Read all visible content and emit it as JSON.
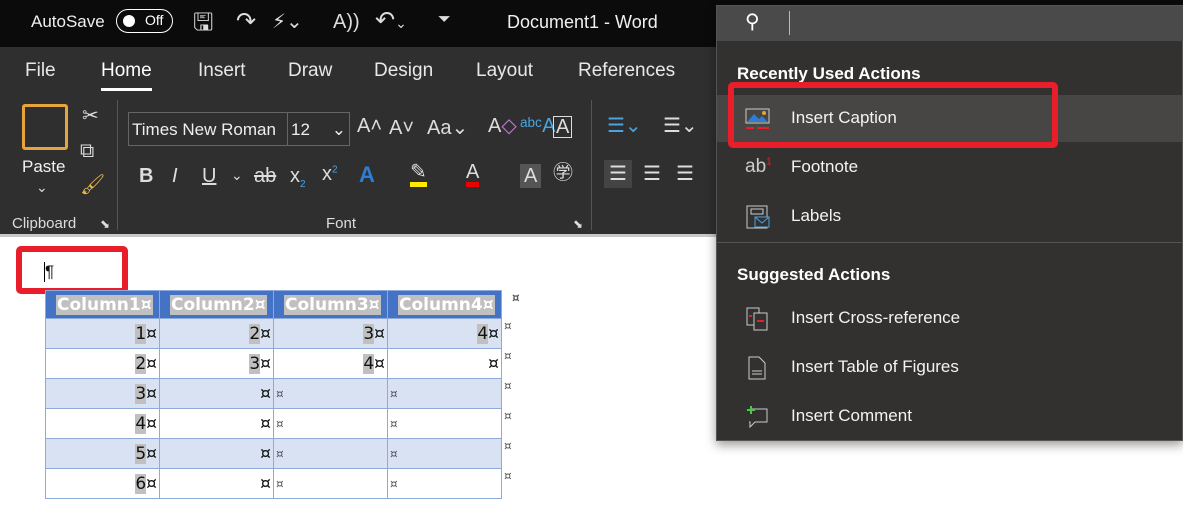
{
  "titlebar": {
    "autosave_label": "AutoSave",
    "autosave_state": "Off",
    "document_title": "Document1  -  Word"
  },
  "tabs": [
    {
      "label": "File"
    },
    {
      "label": "Home"
    },
    {
      "label": "Insert"
    },
    {
      "label": "Draw"
    },
    {
      "label": "Design"
    },
    {
      "label": "Layout"
    },
    {
      "label": "References"
    }
  ],
  "ribbon": {
    "paste_label": "Paste",
    "font_name": "Times New Roman",
    "font_size": "12",
    "clipboard_group": "Clipboard",
    "font_group": "Font"
  },
  "document": {
    "pilcrow": "¶",
    "table": {
      "headers": [
        "Column1¤",
        "Column2¤",
        "Column3¤",
        "Column4¤"
      ],
      "rows": [
        [
          "1",
          "2",
          "3",
          "4"
        ],
        [
          "2",
          "3",
          "4",
          ""
        ],
        [
          "3",
          "",
          "",
          ""
        ],
        [
          "4",
          "",
          "",
          ""
        ],
        [
          "5",
          "",
          "",
          ""
        ],
        [
          "6",
          "",
          "",
          ""
        ]
      ],
      "cell_marker": "¤",
      "row_marker": "¤"
    }
  },
  "panel": {
    "recent_header": "Recently Used Actions",
    "recent": [
      {
        "label": "Insert Caption",
        "icon": "insert-caption-icon"
      },
      {
        "label": "Footnote",
        "icon": "footnote-icon"
      },
      {
        "label": "Labels",
        "icon": "labels-icon"
      }
    ],
    "suggested_header": "Suggested Actions",
    "suggested": [
      {
        "label": "Insert Cross-reference",
        "icon": "cross-reference-icon"
      },
      {
        "label": "Insert Table of Figures",
        "icon": "table-of-figures-icon"
      },
      {
        "label": "Insert Comment",
        "icon": "comment-icon"
      }
    ]
  },
  "colors": {
    "highlight_red": "#e81f2a",
    "header_blue": "#4472c4",
    "band": "#d9e2f3"
  }
}
